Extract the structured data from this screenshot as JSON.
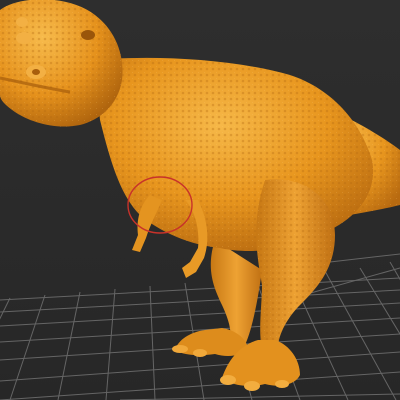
{
  "viewport": {
    "background_color": "#2b2b2b",
    "grid_color": "#6a6a6a",
    "grid_visible": true
  },
  "model": {
    "subject": "tyrannosaurus-sculpt",
    "material_color": "#e8961e",
    "shadow_color": "#a8600c",
    "highlight_color": "#f5b443"
  },
  "selection": {
    "brush_circle_color": "#c8322a"
  }
}
